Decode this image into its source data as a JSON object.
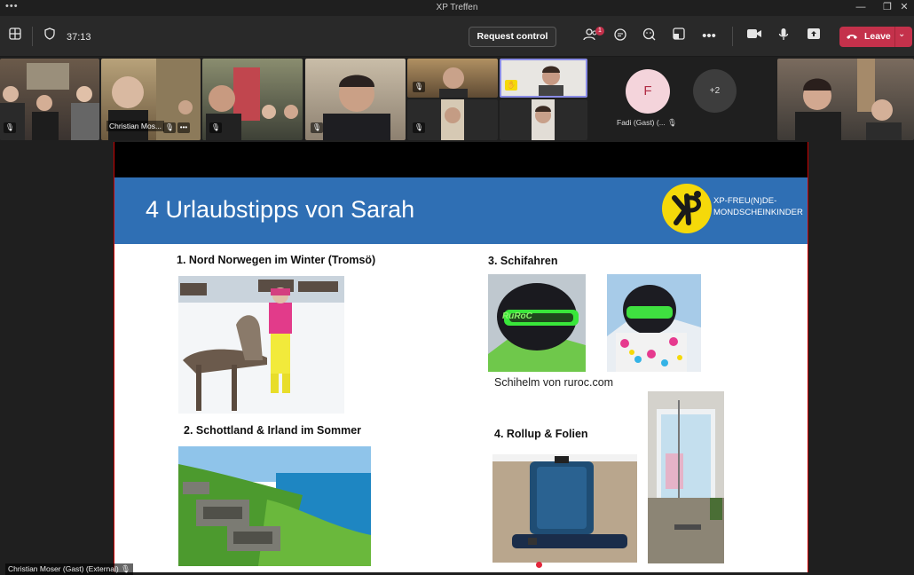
{
  "window": {
    "title": "XP Treffen",
    "menu_glyph": "•••"
  },
  "toolbar": {
    "timer": "37:13",
    "request_control_label": "Request control",
    "notifications_count": "1",
    "more_glyph": "•••",
    "leave_label": "Leave"
  },
  "participants": {
    "tile2_name": "Christian Mos...",
    "tile2_more": "•••",
    "avatar_initial": "F",
    "avatar_name": "Fadi (Gast) (...",
    "overflow_count": "+2"
  },
  "slide": {
    "title": "4 Urlaubstipps von Sarah",
    "logo_text_line1": "XP-FREU(N)DE-",
    "logo_text_line2": "MONDSCHEINKINDER",
    "section1": "1. Nord Norwegen im Winter (Tromsö)",
    "section2": "2. Schottland & Irland im Sommer",
    "section3": "3. Schifahren",
    "section3_caption": "Schihelm von ruroc.com",
    "helmet_brand": "RuRoC",
    "section4": "4. Rollup & Folien"
  },
  "presenter": {
    "label": "Christian Moser (Gast) (External)"
  },
  "colors": {
    "slide_header": "#2f6fb4",
    "leave": "#c4314b",
    "logo": "#f5d90a",
    "raised_hand_border": "#8a8ce6"
  }
}
